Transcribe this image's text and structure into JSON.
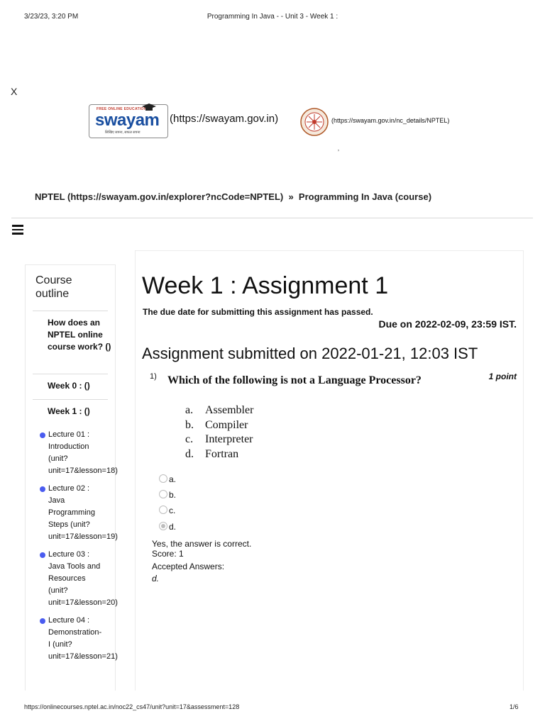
{
  "print_header": {
    "datetime": "3/23/23, 3:20 PM",
    "title": "Programming In Java - - Unit 3 - Week 1 :"
  },
  "close_label": "X",
  "logos": {
    "swayam_tagline": "FREE ONLINE EDUCATION",
    "swayam_wordmark": "swayam",
    "swayam_subtitle": "सिखिए सपना, सफल सपना",
    "swayam_link": "(https://swayam.gov.in)",
    "nptel_link": "(https://swayam.gov.in/nc_details/NPTEL)",
    "tick": "ʼ"
  },
  "breadcrumb": {
    "home": "NPTEL (https://swayam.gov.in/explorer?ncCode=NPTEL)",
    "separator": "»",
    "current": "Programming In Java (course)"
  },
  "sidebar": {
    "title": "Course outline",
    "items": [
      {
        "label": "How does an NPTEL online course work? ()"
      },
      {
        "label": "Week 0 : ()"
      },
      {
        "label": "Week 1 : ()"
      }
    ],
    "lectures": [
      {
        "label": "Lecture 01 : Introduction (unit?unit=17&lesson=18)"
      },
      {
        "label": "Lecture 02 : Java Programming Steps (unit?unit=17&lesson=19)"
      },
      {
        "label": "Lecture 03 : Java Tools and Resources (unit?unit=17&lesson=20)"
      },
      {
        "label": "Lecture 04 : Demonstration-I (unit?unit=17&lesson=21)"
      }
    ],
    "accent_color": "#4a5cf0"
  },
  "main": {
    "title": "Week 1 : Assignment 1",
    "due_note": "The due date for submitting this assignment has passed.",
    "due_date": "Due on 2022-02-09, 23:59 IST.",
    "submitted": "Assignment submitted on 2022-01-21, 12:03 IST",
    "question": {
      "number": "1)",
      "text": "Which of the following is not a Language Processor?",
      "points": "1 point",
      "options": [
        {
          "letter": "a.",
          "text": "Assembler"
        },
        {
          "letter": "b.",
          "text": "Compiler"
        },
        {
          "letter": "c.",
          "text": "Interpreter"
        },
        {
          "letter": "d.",
          "text": "Fortran"
        }
      ],
      "radio_choices": [
        "a.",
        "b.",
        "c.",
        "d."
      ],
      "selected_choice": "d.",
      "feedback": "Yes, the answer is correct.",
      "score": "Score: 1",
      "accepted_label": "Accepted Answers:",
      "accepted_value": "d."
    }
  },
  "print_footer": {
    "url": "https://onlinecourses.nptel.ac.in/noc22_cs47/unit?unit=17&assessment=128",
    "page": "1/6"
  }
}
